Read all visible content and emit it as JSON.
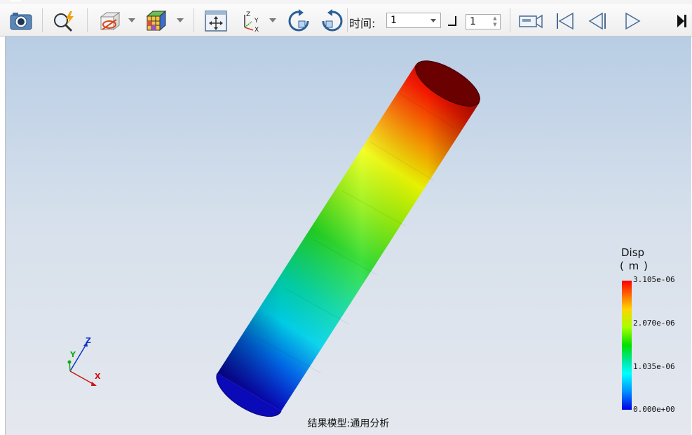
{
  "menu": {
    "items": [
      "",
      "",
      "",
      ""
    ]
  },
  "toolbar": {
    "time_label": "时间:",
    "time_value": "1",
    "step_value": "1",
    "buttons": [
      {
        "name": "screenshot-camera-icon"
      },
      {
        "name": "probe-search-icon"
      },
      {
        "name": "clip-plane-icon"
      },
      {
        "name": "color-cube-icon"
      },
      {
        "name": "fit-view-icon"
      },
      {
        "name": "axis-orientation-icon"
      },
      {
        "name": "rotate-cw-icon"
      },
      {
        "name": "rotate-ccw-icon"
      },
      {
        "name": "record-video-icon"
      },
      {
        "name": "skip-to-start-icon"
      },
      {
        "name": "step-back-icon"
      },
      {
        "name": "play-icon"
      },
      {
        "name": "more-icon"
      }
    ]
  },
  "viewport": {
    "model_label": "结果模型:通用分析",
    "axes": {
      "x": "X",
      "y": "Y",
      "z": "Z"
    }
  },
  "legend": {
    "title": "Disp",
    "unit": "( m )",
    "ticks": [
      "3.105e-06",
      "2.070e-06",
      "1.035e-06",
      "0.000e+00"
    ],
    "max": 3.105e-06,
    "min": 0.0
  },
  "colors": {
    "high": "#ff0000",
    "mid": "#00e000",
    "low": "#0000e6",
    "background_top": "#b8cde4",
    "background_bottom": "#e5e8ee"
  }
}
